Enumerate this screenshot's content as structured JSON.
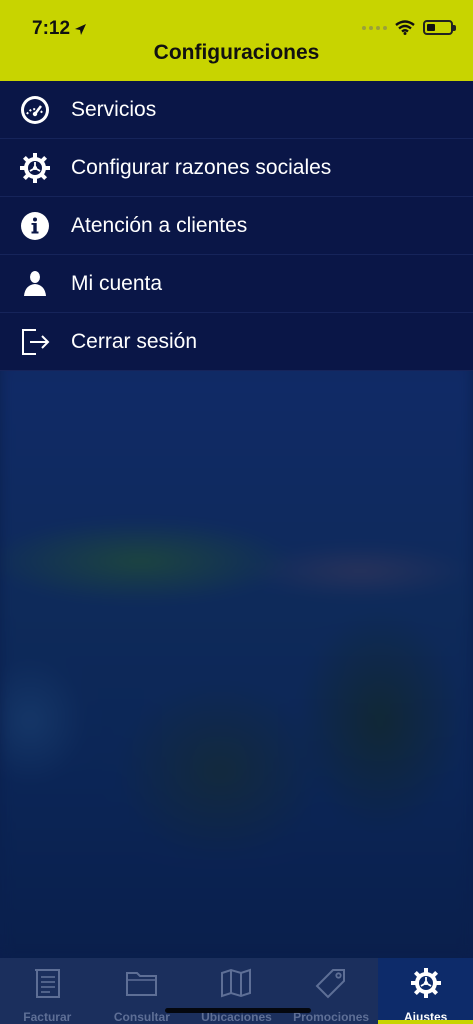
{
  "status_bar": {
    "time": "7:12"
  },
  "header": {
    "title": "Configuraciones"
  },
  "menu": {
    "items": [
      {
        "label": "Servicios",
        "icon": "speedometer-icon"
      },
      {
        "label": "Configurar razones sociales",
        "icon": "gear-icon"
      },
      {
        "label": "Atención a clientes",
        "icon": "info-icon"
      },
      {
        "label": "Mi cuenta",
        "icon": "user-icon"
      },
      {
        "label": "Cerrar sesión",
        "icon": "logout-icon"
      }
    ]
  },
  "tabbar": {
    "tabs": [
      {
        "label": "Facturar",
        "icon": "invoice-icon"
      },
      {
        "label": "Consultar",
        "icon": "folder-icon"
      },
      {
        "label": "Ubicaciones",
        "icon": "map-icon"
      },
      {
        "label": "Promociones",
        "icon": "tag-icon"
      },
      {
        "label": "Ajustes",
        "icon": "gear-icon"
      }
    ],
    "active_index": 4
  },
  "colors": {
    "accent": "#c8d400",
    "menu_bg": "#0a1647",
    "tabbar_bg": "#1b2f5d"
  }
}
